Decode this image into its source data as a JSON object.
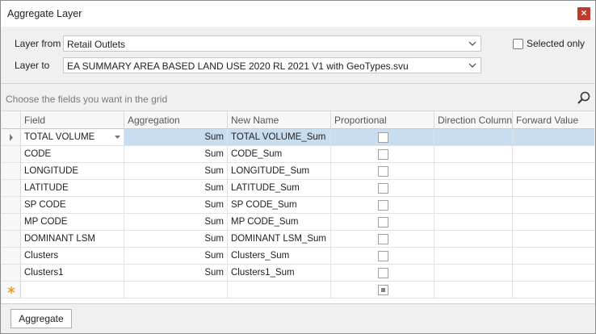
{
  "window": {
    "title": "Aggregate Layer",
    "close": "×"
  },
  "form": {
    "layer_from_label": "Layer from",
    "layer_from_value": "Retail Outlets",
    "layer_to_label": "Layer to",
    "layer_to_value": "EA SUMMARY AREA BASED LAND USE 2020 RL 2021 V1 with GeoTypes.svu",
    "selected_only_label": "Selected only",
    "selected_only_checked": false
  },
  "grid": {
    "find_placeholder": "Choose the fields you want in the grid",
    "columns": [
      "Field",
      "Aggregation",
      "New Name",
      "Proportional",
      "Direction Column",
      "Forward Value"
    ],
    "rows": [
      {
        "field": "TOTAL VOLUME",
        "aggregation": "Sum",
        "new_name": "TOTAL VOLUME_Sum"
      },
      {
        "field": "CODE",
        "aggregation": "Sum",
        "new_name": "CODE_Sum"
      },
      {
        "field": "LONGITUDE",
        "aggregation": "Sum",
        "new_name": "LONGITUDE_Sum"
      },
      {
        "field": "LATITUDE",
        "aggregation": "Sum",
        "new_name": "LATITUDE_Sum"
      },
      {
        "field": "SP CODE",
        "aggregation": "Sum",
        "new_name": "SP CODE_Sum"
      },
      {
        "field": "MP CODE",
        "aggregation": "Sum",
        "new_name": "MP CODE_Sum"
      },
      {
        "field": "DOMINANT LSM",
        "aggregation": "Sum",
        "new_name": "DOMINANT LSM_Sum"
      },
      {
        "field": "Clusters",
        "aggregation": "Sum",
        "new_name": "Clusters_Sum"
      },
      {
        "field": "Clusters1",
        "aggregation": "Sum",
        "new_name": "Clusters1_Sum"
      }
    ]
  },
  "footer": {
    "aggregate_label": "Aggregate"
  },
  "colors": {
    "selected_row": "#c8def0",
    "close_button": "#c0392b"
  }
}
